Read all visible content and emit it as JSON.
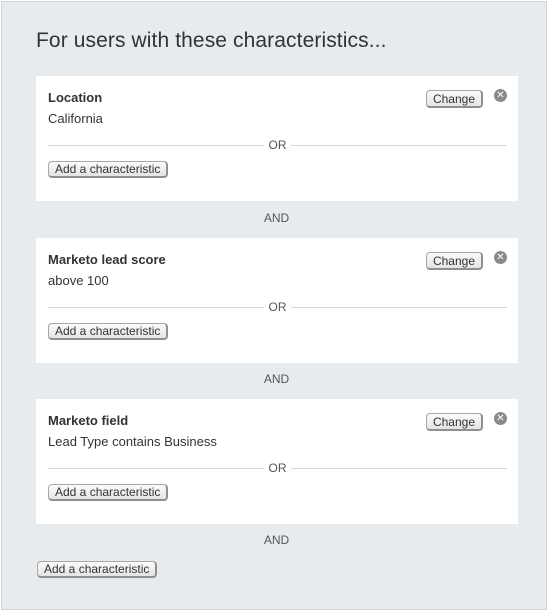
{
  "heading": "For users with these characteristics...",
  "cards": [
    {
      "title": "Location",
      "value": "California",
      "change_label": "Change",
      "or_label": "OR",
      "add_label": "Add a characteristic"
    },
    {
      "title": "Marketo lead score",
      "value": "above 100",
      "change_label": "Change",
      "or_label": "OR",
      "add_label": "Add a characteristic"
    },
    {
      "title": "Marketo field",
      "value": "Lead Type contains Business",
      "change_label": "Change",
      "or_label": "OR",
      "add_label": "Add a characteristic"
    }
  ],
  "and_label": "AND",
  "add_bottom_label": "Add a characteristic",
  "icons": {
    "remove": "close-circle-icon"
  }
}
